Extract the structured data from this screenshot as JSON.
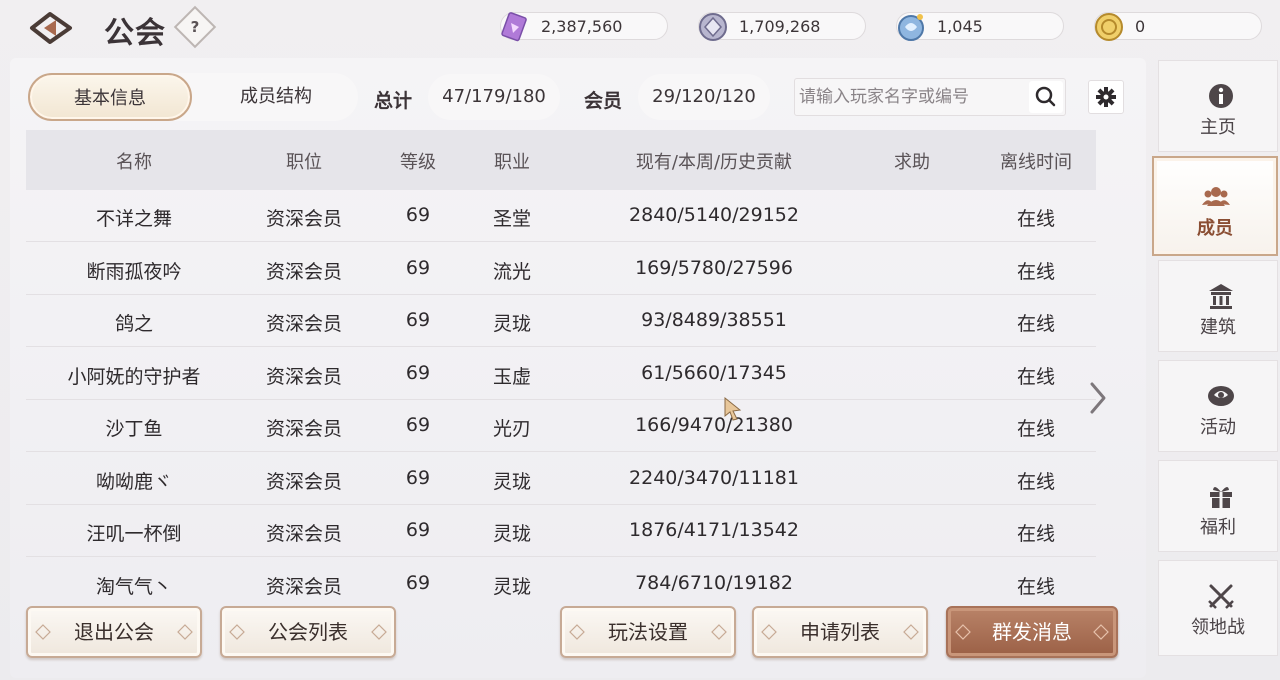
{
  "header": {
    "title": "公会",
    "help_label": "?",
    "currencies": [
      {
        "icon": "crystal-card-icon",
        "value": "2,387,560"
      },
      {
        "icon": "silver-coin-icon",
        "value": "1,709,268"
      },
      {
        "icon": "blue-gem-icon",
        "value": "1,045"
      },
      {
        "icon": "gold-coin-icon",
        "value": "0"
      }
    ]
  },
  "tabs": [
    {
      "label": "基本信息",
      "active": true
    },
    {
      "label": "成员结构",
      "active": false
    }
  ],
  "stats": {
    "total_label": "总计",
    "total_value": "47/179/180",
    "member_label": "会员",
    "member_value": "29/120/120"
  },
  "search": {
    "placeholder": "请输入玩家名字或编号",
    "value": ""
  },
  "table": {
    "columns": [
      "名称",
      "职位",
      "等级",
      "职业",
      "现有/本周/历史贡献",
      "求助",
      "离线时间"
    ],
    "rows": [
      {
        "name": "不详之舞",
        "position": "资深会员",
        "level": "69",
        "job": "圣堂",
        "contribution": "2840/5140/29152",
        "help": "",
        "offline": "在线"
      },
      {
        "name": "断雨孤夜吟",
        "position": "资深会员",
        "level": "69",
        "job": "流光",
        "contribution": "169/5780/27596",
        "help": "",
        "offline": "在线"
      },
      {
        "name": "鸽之",
        "position": "资深会员",
        "level": "69",
        "job": "灵珑",
        "contribution": "93/8489/38551",
        "help": "",
        "offline": "在线"
      },
      {
        "name": "小阿妩的守护者",
        "position": "资深会员",
        "level": "69",
        "job": "玉虚",
        "contribution": "61/5660/17345",
        "help": "",
        "offline": "在线"
      },
      {
        "name": "沙丁鱼",
        "position": "资深会员",
        "level": "69",
        "job": "光刃",
        "contribution": "166/9470/21380",
        "help": "",
        "offline": "在线"
      },
      {
        "name": "呦呦鹿ヾ",
        "position": "资深会员",
        "level": "69",
        "job": "灵珑",
        "contribution": "2240/3470/11181",
        "help": "",
        "offline": "在线"
      },
      {
        "name": "汪叽一杯倒",
        "position": "资深会员",
        "level": "69",
        "job": "灵珑",
        "contribution": "1876/4171/13542",
        "help": "",
        "offline": "在线"
      },
      {
        "name": "淘气气丶",
        "position": "资深会员",
        "level": "69",
        "job": "灵珑",
        "contribution": "784/6710/19182",
        "help": "",
        "offline": "在线"
      }
    ]
  },
  "buttons": {
    "leave": "退出公会",
    "guild_list": "公会列表",
    "play_settings": "玩法设置",
    "apply_list": "申请列表",
    "broadcast": "群发消息"
  },
  "sidenav": [
    {
      "label": "主页",
      "icon": "info-icon",
      "active": false
    },
    {
      "label": "成员",
      "icon": "members-icon",
      "active": true
    },
    {
      "label": "建筑",
      "icon": "building-icon",
      "active": false
    },
    {
      "label": "活动",
      "icon": "activity-icon",
      "active": false
    },
    {
      "label": "福利",
      "icon": "gift-icon",
      "active": false
    },
    {
      "label": "领地战",
      "icon": "crossed-swords-icon",
      "active": false
    }
  ],
  "colors": {
    "accent": "#c9a78a",
    "primary_button": "#a8694e",
    "active_nav_text": "#8a4e33"
  }
}
